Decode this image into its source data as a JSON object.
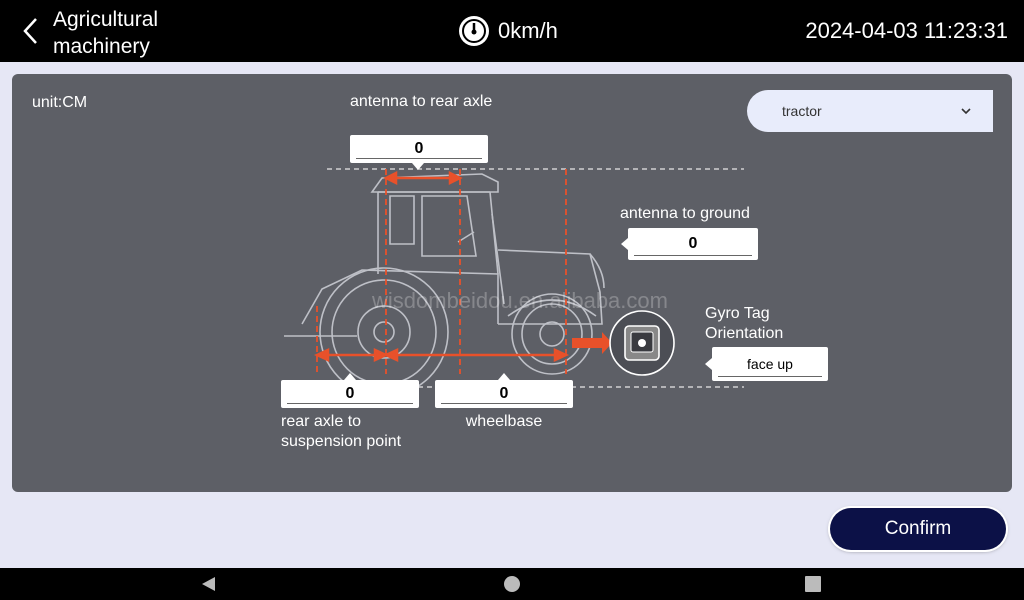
{
  "header": {
    "title": "Agricultural machinery",
    "speed": "0km/h",
    "datetime": "2024-04-03 11:23:31"
  },
  "panel": {
    "unit": "unit:CM",
    "vehicle_type": {
      "selected": "tractor"
    },
    "antenna_to_rear_axle": {
      "label": "antenna to rear axle",
      "value": "0"
    },
    "antenna_to_ground": {
      "label": "antenna to ground",
      "value": "0"
    },
    "rear_axle_to_suspension": {
      "label": "rear axle to suspension point",
      "value": "0"
    },
    "wheelbase": {
      "label": "wheelbase",
      "value": "0"
    },
    "gyro": {
      "label": "Gyro Tag Orientation",
      "value": "face up"
    }
  },
  "confirm_label": "Confirm",
  "watermark": "wisdombeidou.en.alibaba.com",
  "colors": {
    "accent": "#e8512a",
    "panel": "#5d5f66",
    "confirm": "#0c1147"
  }
}
